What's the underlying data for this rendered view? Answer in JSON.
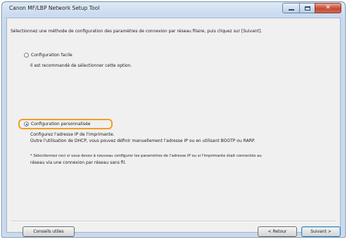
{
  "window": {
    "title": "Canon MF/LBP Network Setup Tool"
  },
  "main": {
    "instruction": "Sélectionnez une méthode de configuration des paramètres de connexion par réseau filaire, puis cliquez sur [Suivant].",
    "options": [
      {
        "label": "Configuration facile",
        "selected": false,
        "description": [
          "Il est recommandé de sélectionner cette option."
        ]
      },
      {
        "label": "Configuration personnalisée",
        "selected": true,
        "description": [
          "Configurez l'adresse IP de l'imprimante.",
          "Outre l'utilisation de DHCP, vous pouvez définir manuellement l'adresse IP ou en utilisant BOOTP ou RARP."
        ]
      }
    ],
    "note": [
      "* Sélectionnez ceci si vous devez à nouveau configurer les paramètres de l'adresse IP ou si l'imprimante était connectée au",
      "réseau via une connexion par réseau sans fil."
    ]
  },
  "footer": {
    "tips_label": "Conseils utiles",
    "back_label": "< Retour",
    "next_label": "Suivant >"
  },
  "colors": {
    "highlight": "#f0a020",
    "close_button": "#c44a32"
  }
}
